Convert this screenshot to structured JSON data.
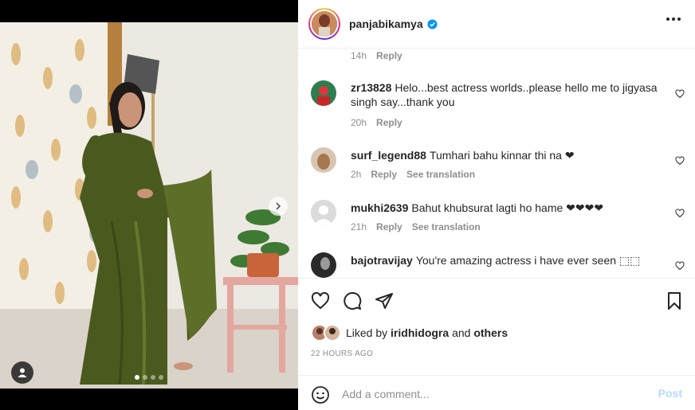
{
  "post": {
    "username": "panjabikamya",
    "verified_icon": "verified-badge-icon",
    "more_icon": "more-options-icon"
  },
  "media": {
    "dots_count": 4,
    "active_dot": 0,
    "next_icon": "chevron-right-icon",
    "tag_icon": "user-tag-icon"
  },
  "comments": {
    "top_meta": {
      "time": "14h",
      "reply": "Reply"
    },
    "items": [
      {
        "user": "zr13828",
        "text": "Helo...best actress worlds..please hello me to jigyasa singh say...thank you",
        "time": "20h",
        "reply": "Reply",
        "translation": ""
      },
      {
        "user": "surf_legend88",
        "text": "Tumhari bahu kinnar thi na ❤",
        "time": "2h",
        "reply": "Reply",
        "translation": "See translation"
      },
      {
        "user": "mukhi2639",
        "text": "Bahut khubsurat lagti ho hame ❤❤❤❤",
        "time": "21h",
        "reply": "Reply",
        "translation": "See translation"
      },
      {
        "user": "bajotravijay",
        "text": "You're amazing actress i have ever seen ⬚⬚",
        "time": "",
        "reply": "",
        "translation": ""
      }
    ]
  },
  "actions": {
    "like_icon": "heart-icon",
    "comment_icon": "comment-icon",
    "share_icon": "share-icon",
    "save_icon": "bookmark-icon"
  },
  "likes": {
    "prefix": "Liked by",
    "user": "iridhidogra",
    "joiner": "and",
    "others": "others"
  },
  "timestamp": "22 HOURS AGO",
  "add_comment": {
    "placeholder": "Add a comment...",
    "post_label": "Post",
    "emoji_icon": "emoji-icon"
  },
  "colors": {
    "accent": "#0095f6",
    "post_disabled": "#b3dbff",
    "muted": "#8e8e8e",
    "saree": "#4a5a1e"
  }
}
